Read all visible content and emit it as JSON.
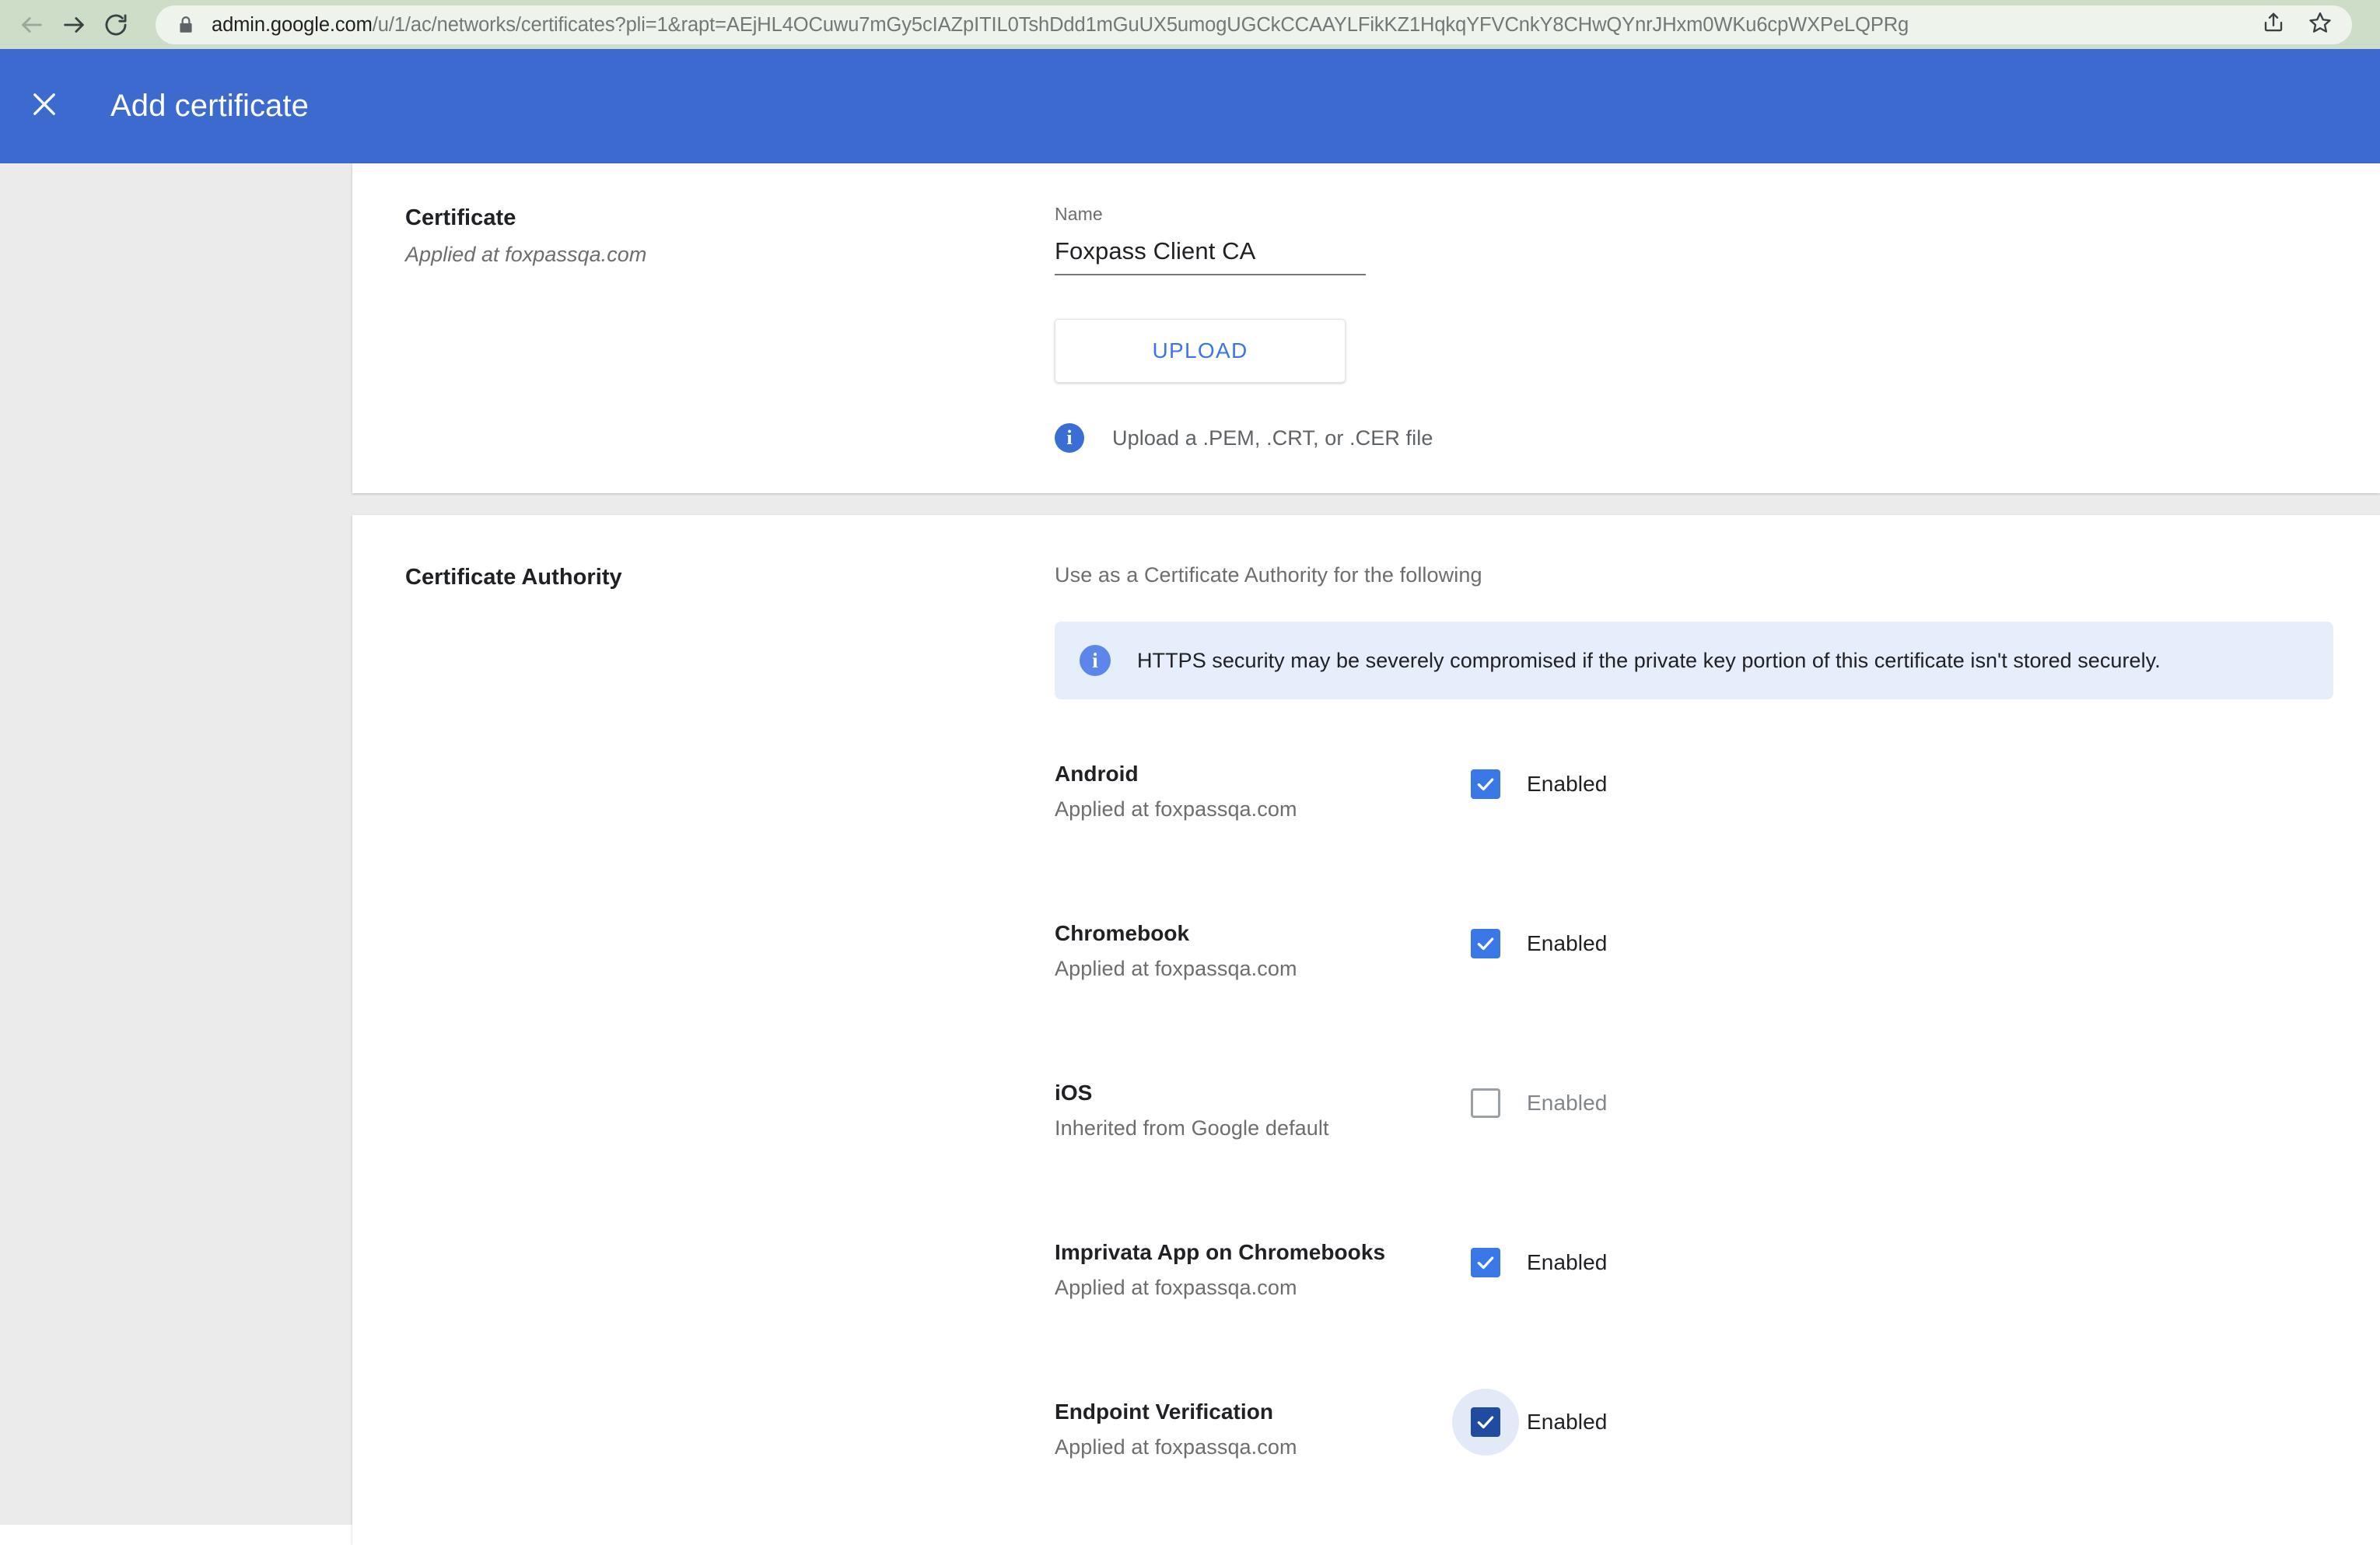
{
  "browser": {
    "back_icon": "arrow-left-icon",
    "forward_icon": "arrow-right-icon",
    "reload_icon": "reload-icon",
    "lock_icon": "lock-icon",
    "url_host": "admin.google.com",
    "url_path": "/u/1/ac/networks/certificates?pli=1&rapt=AEjHL4OCuwu7mGy5cIAZpITIL0TshDdd1mGuUX5umogUGCkCCAAYLFikKZ1HqkqYFVCnkY8CHwQYnrJHxm0WKu6cpWXPeLQPRg",
    "share_icon": "share-icon",
    "bookmark_icon": "star-icon"
  },
  "app_bar": {
    "close_icon": "close-icon",
    "title": "Add certificate",
    "accent_color": "#3c6ace"
  },
  "certificate_section": {
    "title": "Certificate",
    "subtitle": "Applied at foxpassqa.com",
    "name_label": "Name",
    "name_value": "Foxpass Client CA",
    "name_placeholder": "Name",
    "upload_button": "UPLOAD",
    "upload_button_color": "#3b75e8",
    "info_icon": "info-icon",
    "info_text": "Upload a .PEM, .CRT, or .CER file"
  },
  "certificate_authority_section": {
    "title": "Certificate Authority",
    "intro": "Use as a Certificate Authority for the following",
    "banner": {
      "icon": "info-icon",
      "text": "HTTPS security may be severely compromised if the private key portion of this certificate isn't stored securely.",
      "background_color": "#e6eefc"
    },
    "platforms": [
      {
        "name": "Android",
        "sub": "Applied at foxpassqa.com",
        "checkbox_label": "Enabled",
        "checked": true,
        "focused": false,
        "disabled": false
      },
      {
        "name": "Chromebook",
        "sub": "Applied at foxpassqa.com",
        "checkbox_label": "Enabled",
        "checked": true,
        "focused": false,
        "disabled": false
      },
      {
        "name": "iOS",
        "sub": "Inherited from Google default",
        "checkbox_label": "Enabled",
        "checked": false,
        "focused": false,
        "disabled": true
      },
      {
        "name": "Imprivata App on Chromebooks",
        "sub": "Applied at foxpassqa.com",
        "checkbox_label": "Enabled",
        "checked": true,
        "focused": false,
        "disabled": false
      },
      {
        "name": "Endpoint Verification",
        "sub": "Applied at foxpassqa.com",
        "checkbox_label": "Enabled",
        "checked": true,
        "focused": true,
        "disabled": false
      }
    ]
  }
}
